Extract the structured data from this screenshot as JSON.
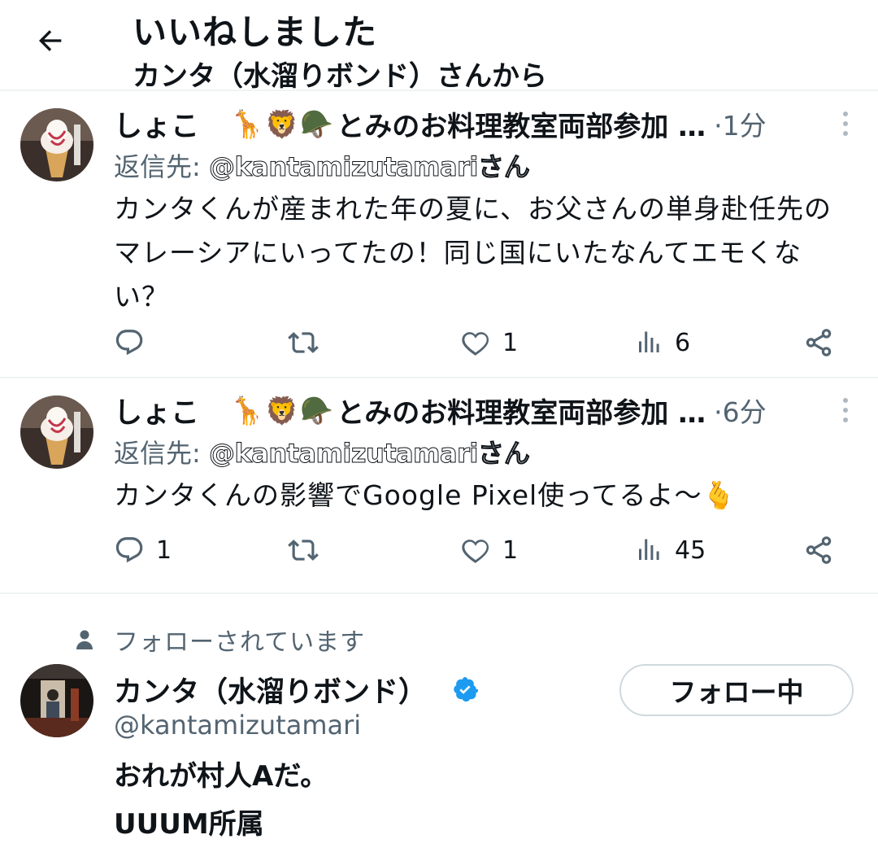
{
  "header": {
    "title": "いいねしました",
    "subtitle": "カンタ（水溜りボンド）さんから"
  },
  "tweets": [
    {
      "name": "しょこ",
      "name_tail": "とみのお料理教室両部参加 …",
      "emojis": [
        "🦒",
        "🦁",
        "🪖"
      ],
      "time": "·1分",
      "reply_prefix": "返信先: ",
      "reply_handle": "@kantamizutamari",
      "reply_suffix": "さん",
      "text": "カンタくんが産まれた年の夏に、お父さんの単身赴任先のマレーシアにいってたの！同じ国にいたなんてエモくない？",
      "replies": "",
      "retweets": "",
      "likes": "1",
      "views": "6"
    },
    {
      "name": "しょこ",
      "name_tail": "とみのお料理教室両部参加 …",
      "emojis": [
        "🦒",
        "🦁",
        "🪖"
      ],
      "time": "·6分",
      "reply_prefix": "返信先: ",
      "reply_handle": "@kantamizutamari",
      "reply_suffix": "さん",
      "text": "カンタくんの影響でGoogle Pixel使ってるよ〜🫰",
      "replies": "1",
      "retweets": "",
      "likes": "1",
      "views": "45"
    }
  ],
  "follow_card": {
    "context": "フォローされています",
    "name": "カンタ（水溜りボンド）",
    "handle": "@kantamizutamari",
    "bio_line1": "おれが村人Aだ。",
    "bio_line2": "UUUM所属",
    "button_label": "フォロー中"
  },
  "colors": {
    "text": "#0f1419",
    "secondary": "#536471",
    "verified": "#1d9bf0",
    "divider": "#eff3f4"
  }
}
